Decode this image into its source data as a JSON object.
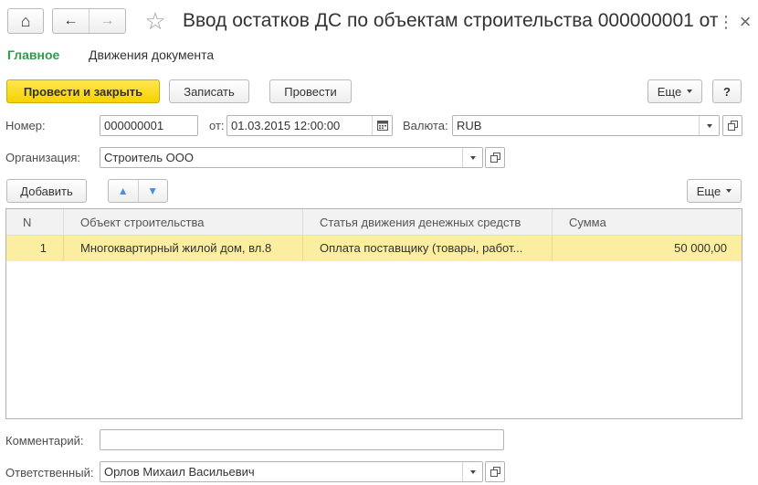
{
  "window": {
    "title": "Ввод остатков ДС по объектам строительства 000000001 от ...",
    "more_menu_glyph": "⋮",
    "close_glyph": "×"
  },
  "nav": {
    "home_glyph": "⌂",
    "back_glyph": "←",
    "forward_glyph": "→",
    "favorite_glyph": "☆"
  },
  "tabs": [
    {
      "label": "Главное",
      "active": true
    },
    {
      "label": "Движения документа",
      "active": false
    }
  ],
  "toolbar": {
    "post_close_label": "Провести и закрыть",
    "save_label": "Записать",
    "post_label": "Провести",
    "more_label": "Еще",
    "help_label": "?"
  },
  "form": {
    "number_label": "Номер:",
    "number_value": "000000001",
    "date_label": "от:",
    "date_value": "01.03.2015 12:00:00",
    "currency_label": "Валюта:",
    "currency_value": "RUB",
    "org_label": "Организация:",
    "org_value": "Строитель ООО",
    "comment_label": "Комментарий:",
    "comment_value": "",
    "responsible_label": "Ответственный:",
    "responsible_value": "Орлов Михаил Васильевич"
  },
  "table_toolbar": {
    "add_label": "Добавить",
    "up_glyph": "▲",
    "down_glyph": "▼",
    "more_label": "Еще"
  },
  "table": {
    "columns": [
      "N",
      "Объект строительства",
      "Статья движения денежных средств",
      "Сумма"
    ],
    "rows": [
      {
        "n": "1",
        "object": "Многоквартирный жилой дом, вл.8",
        "article": "Оплата поставщику (товары, работ...",
        "sum": "50 000,00",
        "selected": true
      }
    ]
  },
  "colors": {
    "accent_green": "#2e9c4a",
    "primary_button": "#f6d300",
    "selected_row": "#fbeea0",
    "header_bg": "#f2f2f2"
  }
}
